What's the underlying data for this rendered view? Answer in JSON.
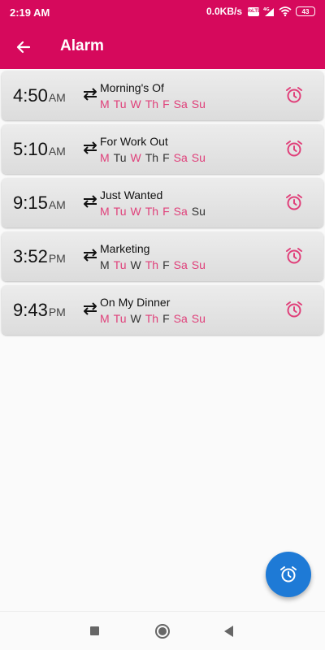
{
  "status_bar": {
    "time": "2:19 AM",
    "net_speed": "0.0KB/s",
    "volte": "VoLTE",
    "network": "4G",
    "battery": "43"
  },
  "app_bar": {
    "title": "Alarm",
    "back_icon": "arrow-left-icon"
  },
  "colors": {
    "primary": "#d6095c",
    "accent_day": "#e0407a",
    "fab": "#1e7ad6"
  },
  "alarms": [
    {
      "time": "4:50",
      "ampm": "AM",
      "label": "Morning's Of",
      "days": [
        {
          "d": "M",
          "on": true
        },
        {
          "d": "Tu",
          "on": true
        },
        {
          "d": "W",
          "on": true
        },
        {
          "d": "Th",
          "on": true
        },
        {
          "d": "F",
          "on": true
        },
        {
          "d": "Sa",
          "on": true
        },
        {
          "d": "Su",
          "on": true
        }
      ]
    },
    {
      "time": "5:10",
      "ampm": "AM",
      "label": "For Work Out",
      "days": [
        {
          "d": "M",
          "on": true
        },
        {
          "d": "Tu",
          "on": false
        },
        {
          "d": "W",
          "on": true
        },
        {
          "d": "Th",
          "on": false
        },
        {
          "d": "F",
          "on": false
        },
        {
          "d": "Sa",
          "on": true
        },
        {
          "d": "Su",
          "on": true
        }
      ]
    },
    {
      "time": "9:15",
      "ampm": "AM",
      "label": "Just Wanted",
      "days": [
        {
          "d": "M",
          "on": true
        },
        {
          "d": "Tu",
          "on": true
        },
        {
          "d": "W",
          "on": true
        },
        {
          "d": "Th",
          "on": true
        },
        {
          "d": "F",
          "on": true
        },
        {
          "d": "Sa",
          "on": true
        },
        {
          "d": "Su",
          "on": false
        }
      ]
    },
    {
      "time": "3:52",
      "ampm": "PM",
      "label": "Marketing",
      "days": [
        {
          "d": "M",
          "on": false
        },
        {
          "d": "Tu",
          "on": true
        },
        {
          "d": "W",
          "on": false
        },
        {
          "d": "Th",
          "on": true
        },
        {
          "d": "F",
          "on": false
        },
        {
          "d": "Sa",
          "on": true
        },
        {
          "d": "Su",
          "on": true
        }
      ]
    },
    {
      "time": "9:43",
      "ampm": "PM",
      "label": "On My Dinner",
      "days": [
        {
          "d": "M",
          "on": true
        },
        {
          "d": "Tu",
          "on": true
        },
        {
          "d": "W",
          "on": false
        },
        {
          "d": "Th",
          "on": true
        },
        {
          "d": "F",
          "on": false
        },
        {
          "d": "Sa",
          "on": true
        },
        {
          "d": "Su",
          "on": true
        }
      ]
    }
  ],
  "fab": {
    "icon": "alarm-add-icon"
  },
  "nav": {
    "recent_icon": "square-icon",
    "home_icon": "home-circle-icon",
    "back_icon": "triangle-back-icon"
  }
}
